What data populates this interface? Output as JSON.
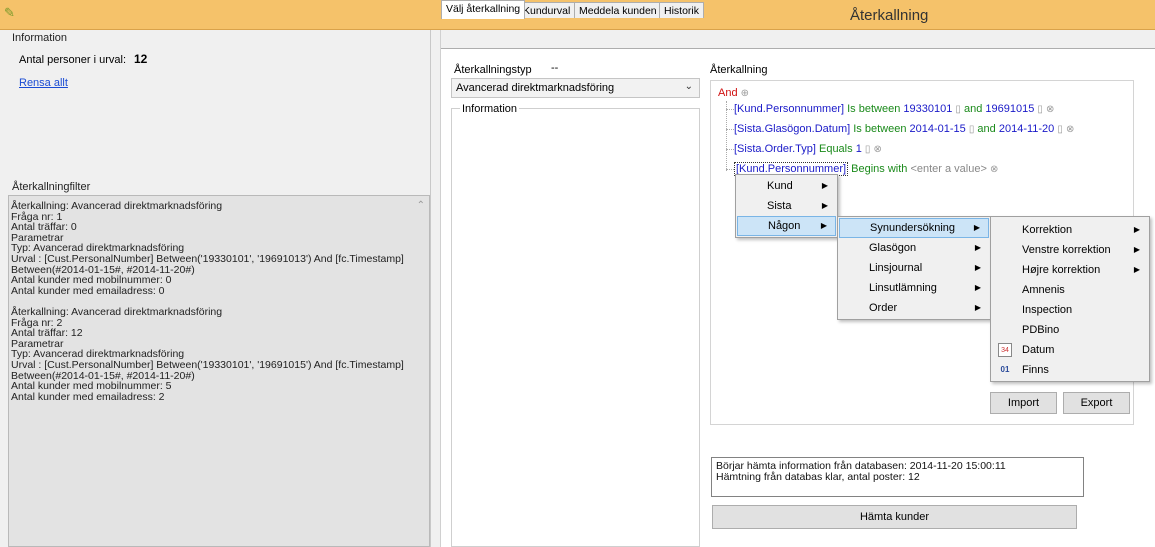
{
  "window": {
    "title": "Återkallning"
  },
  "left": {
    "information_label": "Information",
    "persons_label": "Antal personer i urval:",
    "persons_value": "12",
    "clear_link": "Rensa allt",
    "filter_label": "Återkallningfilter",
    "filter_text": "Återkallning: Avancerad direktmarknadsföring\nFråga nr: 1\nAntal träffar: 0\nParametrar\nTyp: Avancerad direktmarknadsföring\nUrval : [Cust.PersonalNumber] Between('19330101', '19691013') And [fc.Timestamp]\nBetween(#2014-01-15#, #2014-11-20#)\nAntal kunder med mobilnummer: 0\nAntal kunder med emailadress: 0\n\nÅterkallning: Avancerad direktmarknadsföring\nFråga nr: 2\nAntal träffar: 12\nParametrar\nTyp: Avancerad direktmarknadsföring\nUrval : [Cust.PersonalNumber] Between('19330101', '19691015') And [fc.Timestamp]\nBetween(#2014-01-15#, #2014-11-20#)\nAntal kunder med mobilnummer: 5\nAntal kunder med emailadress: 2"
  },
  "tabs": [
    {
      "label": "Välj återkallning"
    },
    {
      "label": "Kundurval"
    },
    {
      "label": "Meddela kunden"
    },
    {
      "label": "Historik"
    }
  ],
  "recall": {
    "type_label": "Återkallningstyp",
    "type_dash": "--",
    "type_value": "Avancerad direktmarknadsföring",
    "info_label": "Information",
    "tree_label": "Återkallning",
    "root": "And",
    "rows": [
      {
        "field": "[Kund.Personnummer]",
        "op": "Is between",
        "v1": "19330101",
        "mid": "and",
        "v2": "19691015"
      },
      {
        "field": "[Sista.Glasögon.Datum]",
        "op": "Is between",
        "v1": "2014-01-15",
        "mid": "and",
        "v2": "2014-11-20"
      },
      {
        "field": "[Sista.Order.Typ]",
        "op": "Equals",
        "v1": "1"
      },
      {
        "field": "[Kund.Personnummer]",
        "op": "Begins with",
        "placeholder": "<enter a value>"
      }
    ],
    "import_label": "Import",
    "export_label": "Export",
    "log_text": "Börjar hämta information från databasen: 2014-11-20 15:00:11\nHämtning från databas klar, antal poster: 12",
    "fetch_label": "Hämta kunder"
  },
  "menu1": [
    "Kund",
    "Sista",
    "Någon"
  ],
  "menu2": [
    "Synundersökning",
    "Glasögon",
    "Linsjournal",
    "Linsutlämning",
    "Order"
  ],
  "menu3": [
    "Korrektion",
    "Venstre korrektion",
    "Højre korrektion",
    "Amnenis",
    "Inspection",
    "PDBino",
    "Datum",
    "Finns"
  ],
  "menu3_icons": {
    "Datum": "34",
    "Finns": "01"
  },
  "colors": {
    "titlebar": "#f5c26a",
    "field": "#1a1ac8",
    "operator": "#1a8a1a",
    "and": "#d01010",
    "highlight": "#cce4f7"
  }
}
